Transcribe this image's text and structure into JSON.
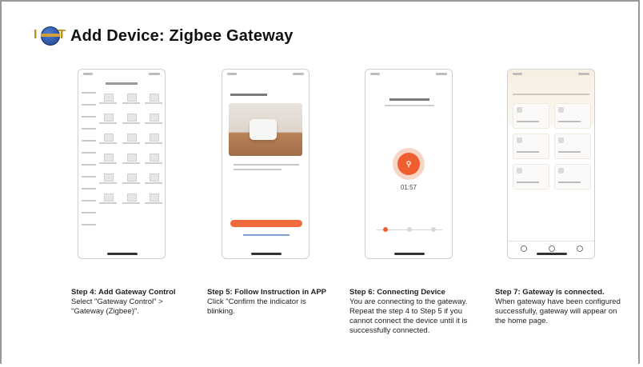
{
  "header": {
    "title": "Add Device: Zigbee Gateway",
    "logo_text_left": "I",
    "logo_text_right": "T"
  },
  "steps": [
    {
      "title": "Step 4: Add Gateway Control",
      "body": "Select \"Gateway Control\" > \"Gateway (Zigbee)\"."
    },
    {
      "title": "Step 5: Follow Instruction in APP",
      "body": "Click \"Confirm the indicator is blinking."
    },
    {
      "title": "Step 6: Connecting Device",
      "body": "You are connecting to the gateway. Repeat the step 4 to Step 5 if you cannot connect the device until it is successfully connected."
    },
    {
      "title": "Step 7: Gateway is connected.",
      "body": "When gateway have been configured successfully, gateway will appear on the home page."
    }
  ],
  "phone3": {
    "timer": "01:57"
  },
  "colors": {
    "accent": "#ef5e2e",
    "frame": "#9a9a9a"
  }
}
